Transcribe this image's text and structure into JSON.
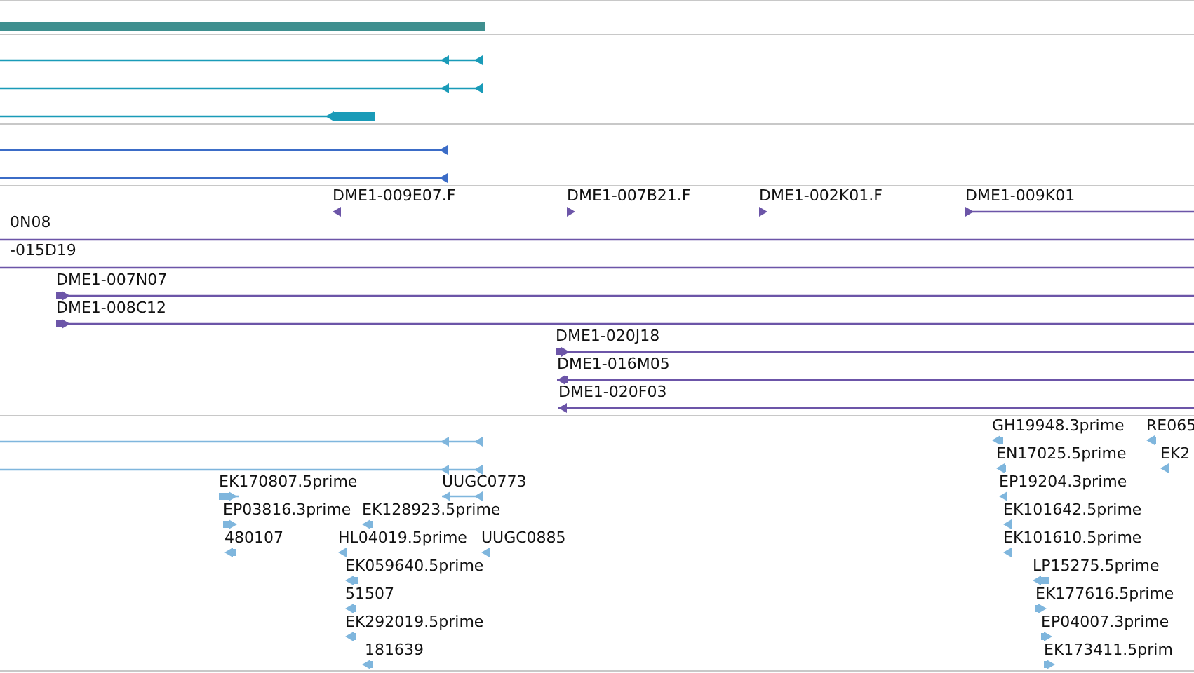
{
  "tracks": [
    {
      "kind": "bar",
      "color": "#3f8f8f"
    },
    {
      "kind": "transcript",
      "color": "#1a9bb8",
      "features": [
        {
          "reverse": true
        },
        {
          "reverse": true
        },
        {
          "reverse": true
        }
      ]
    },
    {
      "kind": "transcript",
      "color": "#3b6cc7",
      "features": [
        {
          "reverse": true
        },
        {
          "reverse": true
        }
      ]
    },
    {
      "kind": "clone",
      "color": "#6c55a8",
      "features": [
        {
          "label": "DME1-009E07.F",
          "reverse": true
        },
        {
          "label": "DME1-007B21.F",
          "reverse": false
        },
        {
          "label": "DME1-002K01.F",
          "reverse": false
        },
        {
          "label": "DME1-009K01",
          "reverse": false
        },
        {
          "label": "0N08"
        },
        {
          "label": "-015D19"
        },
        {
          "label": "DME1-007N07",
          "reverse": false
        },
        {
          "label": "DME1-008C12",
          "reverse": false
        },
        {
          "label": "DME1-020J18",
          "reverse": false
        },
        {
          "label": "DME1-016M05",
          "reverse": true
        },
        {
          "label": "DME1-020F03",
          "reverse": true
        }
      ]
    },
    {
      "kind": "est",
      "color": "#7fb6dd",
      "features": [
        {
          "reverse": true
        },
        {
          "reverse": true
        },
        {
          "label": "EK170807.5prime",
          "reverse": false
        },
        {
          "label": "UUGC0773",
          "reverse": true
        },
        {
          "label": "EP03816.3prime",
          "reverse": false
        },
        {
          "label": "EK128923.5prime",
          "reverse": true
        },
        {
          "label": "480107",
          "reverse": true
        },
        {
          "label": "HL04019.5prime",
          "reverse": true
        },
        {
          "label": "UUGC0885",
          "reverse": true
        },
        {
          "label": "EK059640.5prime",
          "reverse": true
        },
        {
          "label": "51507",
          "reverse": true
        },
        {
          "label": "EK292019.5prime",
          "reverse": true
        },
        {
          "label": "181639",
          "reverse": true
        },
        {
          "label": "GH19948.3prime",
          "reverse": true
        },
        {
          "label": "RE065",
          "reverse": true
        },
        {
          "label": "EN17025.5prime",
          "reverse": true
        },
        {
          "label": "EK2",
          "reverse": true
        },
        {
          "label": "EP19204.3prime",
          "reverse": true
        },
        {
          "label": "EK101642.5prime",
          "reverse": true
        },
        {
          "label": "EK101610.5prime",
          "reverse": true
        },
        {
          "label": "LP15275.5prime",
          "reverse": true
        },
        {
          "label": "EK177616.5prime",
          "reverse": false
        },
        {
          "label": "EP04007.3prime",
          "reverse": false
        },
        {
          "label": "EK173411.5prim",
          "reverse": false
        }
      ]
    }
  ]
}
